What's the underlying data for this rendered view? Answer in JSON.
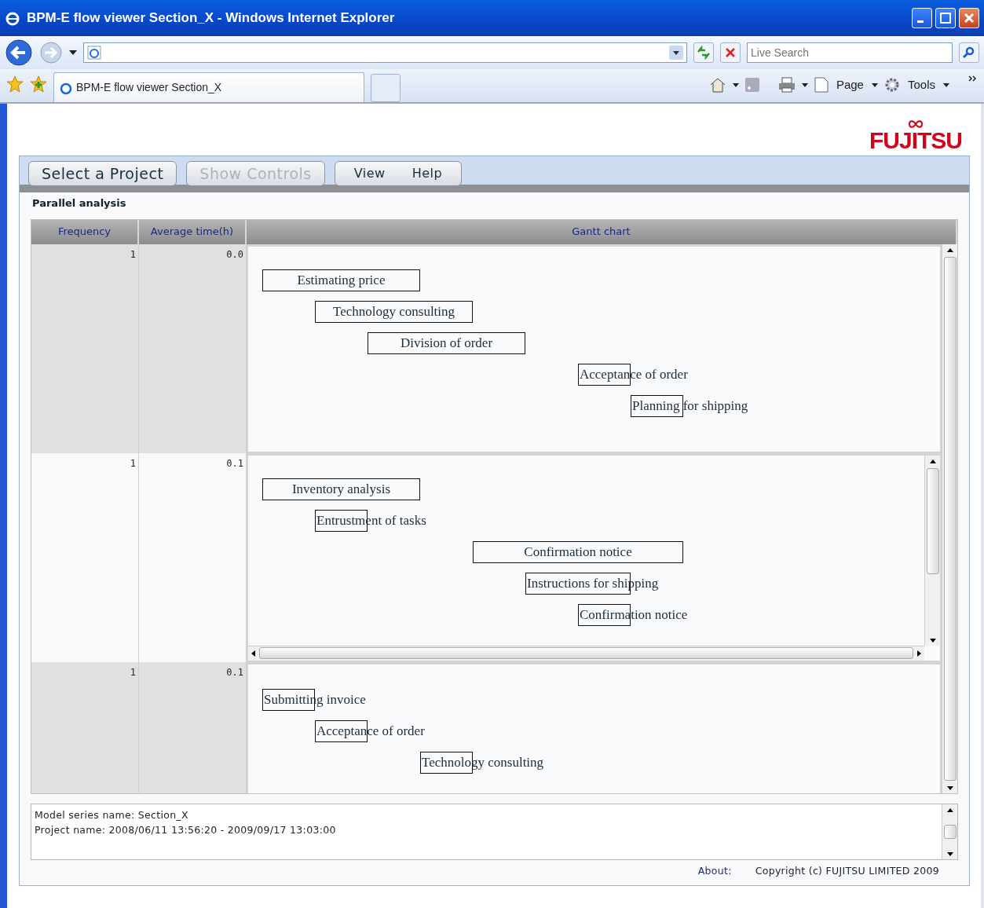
{
  "browser": {
    "title": "BPM-E flow viewer Section_X - Windows Internet Explorer",
    "search": {
      "placeholder": "Live Search"
    },
    "tab": {
      "title": "BPM-E flow viewer Section_X"
    },
    "commands": [
      "Page",
      "Tools"
    ]
  },
  "header": {
    "logo": "FUJITSU"
  },
  "menu": [
    {
      "items": [
        {
          "label": "Select a Project",
          "disabled": false
        }
      ]
    },
    {
      "items": [
        {
          "label": "Show Controls",
          "disabled": true
        }
      ]
    },
    {
      "items": [
        {
          "label": "View",
          "disabled": false
        },
        {
          "label": "Help",
          "disabled": false
        }
      ]
    }
  ],
  "section_title": "Parallel analysis",
  "table": {
    "columns": [
      "Frequency",
      "Average time(h)",
      "Gantt chart"
    ],
    "rows": [
      {
        "frequency": "1",
        "average_time": "0.0",
        "tasks": [
          {
            "label": "Estimating price"
          },
          {
            "label": "Technology consulting"
          },
          {
            "label": "Division of order"
          },
          {
            "label": "Acceptance of order"
          },
          {
            "label": "Planning for shipping"
          }
        ]
      },
      {
        "frequency": "1",
        "average_time": "0.1",
        "tasks": [
          {
            "label": "Inventory analysis"
          },
          {
            "label": "Entrustment of tasks"
          },
          {
            "label": "Confirmation notice"
          },
          {
            "label": "Instructions for shipping"
          },
          {
            "label": "Confirmation notice"
          }
        ]
      },
      {
        "frequency": "1",
        "average_time": "0.1",
        "tasks": [
          {
            "label": "Submitting invoice"
          },
          {
            "label": "Acceptance of order"
          },
          {
            "label": "Technology consulting"
          }
        ]
      }
    ]
  },
  "footer": {
    "info": [
      "Model series name: Section_X",
      "Project name: 2008/06/11 13:56:20 - 2009/09/17 13:03:00"
    ],
    "about": "About:",
    "copyright": "Copyright (c) FUJITSU LIMITED 2009"
  }
}
